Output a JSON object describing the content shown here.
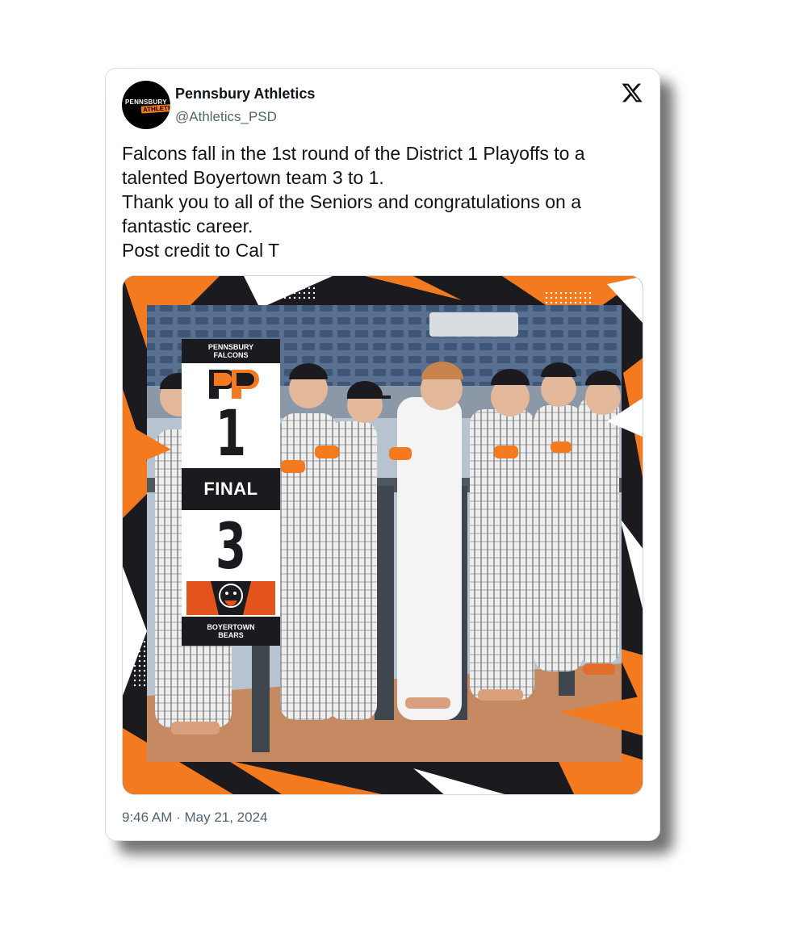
{
  "tweet": {
    "author_name": "Pennsbury Athletics",
    "handle": "@Athletics_PSD",
    "avatar_text_top": "PENNSBURY",
    "avatar_text_bottom": "ATHLETICS",
    "text_lines": [
      "Falcons fall in the 1st round of the District 1 Playoffs to a",
      "talented Boyertown team 3 to 1.",
      "Thank you to all of the Seniors and congratulations on a",
      "fantastic career.",
      "Post credit to Cal T"
    ],
    "timestamp": "9:46 AM · May 21, 2024"
  },
  "graphic": {
    "home_team_line1": "PENNSBURY",
    "home_team_line2": "FALCONS",
    "home_score": "1",
    "status": "FINAL",
    "away_score": "3",
    "away_team_line1": "BOYERTOWN",
    "away_team_line2": "BEARS"
  },
  "colors": {
    "accent_orange": "#f47a20",
    "dark": "#1a1a1f",
    "text_primary": "#0f1419",
    "text_secondary": "#536471"
  },
  "icons": {
    "platform_logo": "x-logo-icon"
  }
}
